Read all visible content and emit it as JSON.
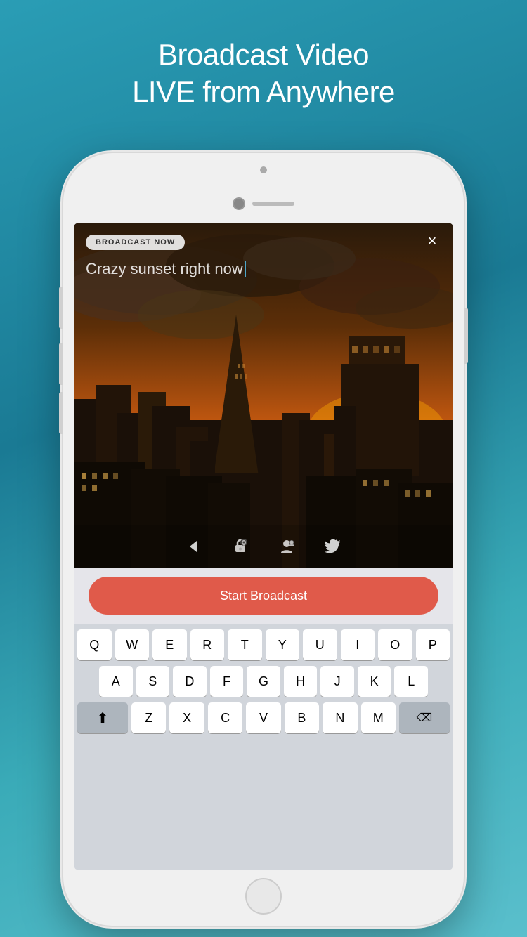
{
  "header": {
    "line1": "Broadcast Video",
    "line2": "LIVE from Anywhere"
  },
  "phone": {
    "badge": "BROADCAST NOW",
    "close_label": "×",
    "title_text": "Crazy sunset right now",
    "start_button_label": "Start Broadcast",
    "icons": [
      {
        "name": "back-arrow-icon",
        "symbol": "◀"
      },
      {
        "name": "location-lock-icon",
        "symbol": "🔒"
      },
      {
        "name": "contacts-icon",
        "symbol": "👤"
      },
      {
        "name": "twitter-icon",
        "symbol": "🐦"
      }
    ]
  },
  "keyboard": {
    "row1": [
      "Q",
      "W",
      "E",
      "R",
      "T",
      "Y",
      "U",
      "I",
      "O",
      "P"
    ],
    "row2": [
      "A",
      "S",
      "D",
      "F",
      "G",
      "H",
      "J",
      "K",
      "L"
    ],
    "row3_special_left": "⬆",
    "row3": [
      "Z",
      "X",
      "C",
      "V",
      "B",
      "N",
      "M"
    ],
    "row3_special_right": "⌫",
    "colors": {
      "background": "#d1d5db",
      "key_bg": "#ffffff",
      "key_dark_bg": "#adb5bd"
    }
  }
}
